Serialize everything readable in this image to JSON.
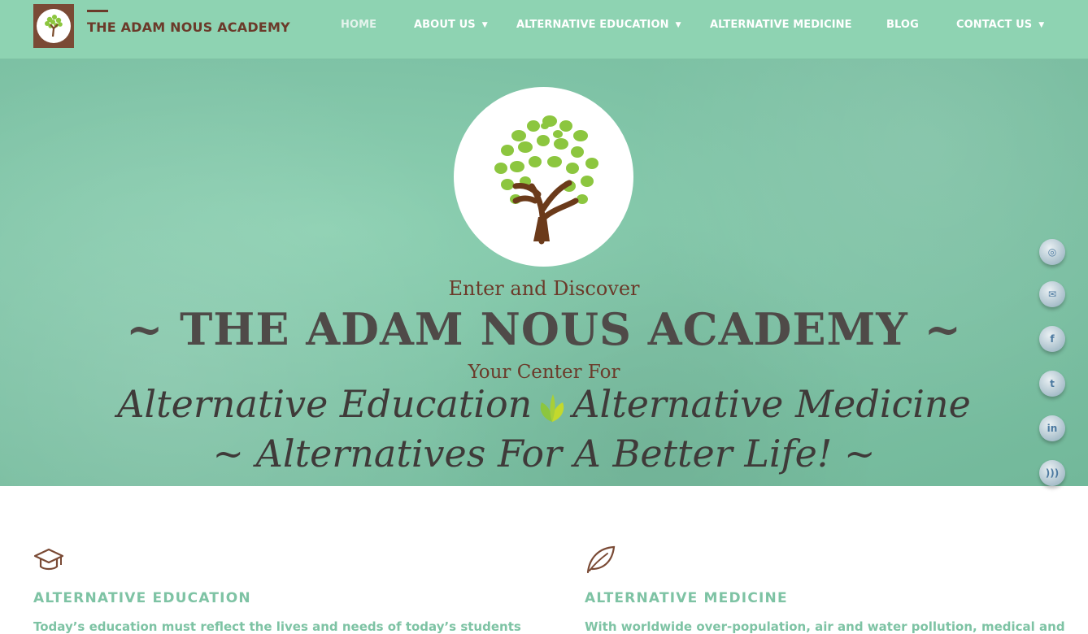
{
  "header": {
    "brand": "THE ADAM NOUS ACADEMY",
    "nav": [
      {
        "label": "HOME"
      },
      {
        "label": "ABOUT US"
      },
      {
        "label": "ALTERNATIVE EDUCATION"
      },
      {
        "label": "ALTERNATIVE MEDICINE"
      },
      {
        "label": "BLOG"
      },
      {
        "label": "CONTACT US"
      }
    ]
  },
  "hero": {
    "line1": "Enter and Discover",
    "title": "~ THE ADAM NOUS ACADEMY ~",
    "line2": "Your Center For",
    "script_left": "Alternative Education",
    "script_right": "Alternative Medicine",
    "script_line2": "~ Alternatives For A Better Life! ~"
  },
  "social": [
    {
      "name": "instagram",
      "glyph": "◎"
    },
    {
      "name": "email",
      "glyph": "✉"
    },
    {
      "name": "facebook",
      "glyph": "f"
    },
    {
      "name": "twitter",
      "glyph": "t"
    },
    {
      "name": "linkedin",
      "glyph": "in"
    },
    {
      "name": "rss",
      "glyph": ")))"
    }
  ],
  "features": [
    {
      "title": "ALTERNATIVE EDUCATION",
      "text": "Today’s education must reflect the lives and needs of today’s students"
    },
    {
      "title": "ALTERNATIVE MEDICINE",
      "text": "With worldwide over-population, air and water pollution, medical and"
    }
  ],
  "colors": {
    "header_bg": "#8ed3b2",
    "brand": "#6b3a2a",
    "accent": "#7ec3a4",
    "title": "#4f4a48"
  }
}
